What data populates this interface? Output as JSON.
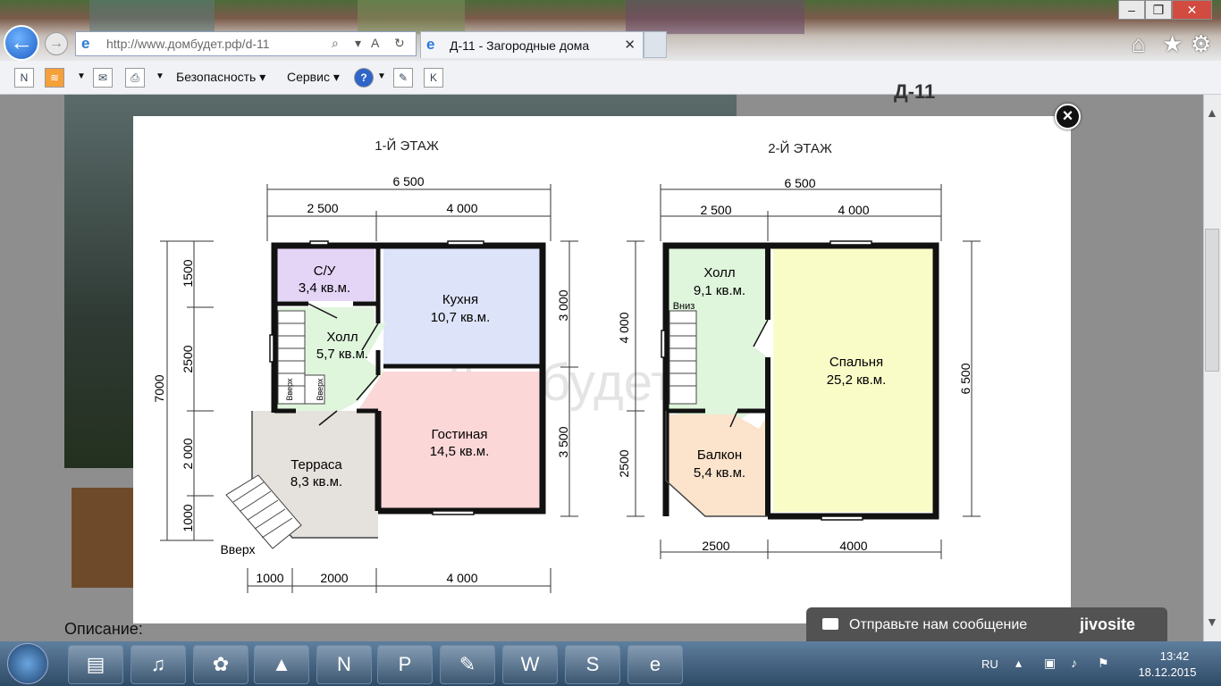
{
  "browser": {
    "url": "http://www.домбудет.рф/d-11",
    "tab_title": "Д-11 - Загородные дома",
    "minimize": "–",
    "restore": "❐",
    "close": "✕",
    "back_glyph": "←",
    "forward_glyph": "→",
    "tab_close": "✕",
    "home_icon": "⌂",
    "favorites_icon": "★",
    "settings_icon": "⚙"
  },
  "command_bar": {
    "security_label": "Безопасность",
    "service_label": "Сервис",
    "help_glyph": "?",
    "k_label": "K"
  },
  "page": {
    "description_label": "Описание:",
    "header_fragment": "Д-11"
  },
  "floorplan": {
    "watermark": "Домбудет.рф",
    "floor1": {
      "title": "1-Й ЭТАЖ",
      "dim_total_top": "6 500",
      "dim_top_left": "2 500",
      "dim_top_right": "4 000",
      "dim_left_total": "7000",
      "dim_left_1": "1500",
      "dim_left_2": "2500",
      "dim_left_3": "2 000",
      "dim_left_4": "1000",
      "dim_right_1": "3 000",
      "dim_right_2": "3 500",
      "dim_bottom_1": "1000",
      "dim_bottom_2": "2000",
      "dim_bottom_3": "4 000",
      "rooms": [
        {
          "name": "С/У",
          "area": "3,4 кв.м."
        },
        {
          "name": "Кухня",
          "area": "10,7 кв.м."
        },
        {
          "name": "Холл",
          "area": "5,7 кв.м."
        },
        {
          "name": "Гостиная",
          "area": "14,5 кв.м."
        },
        {
          "name": "Терраса",
          "area": "8,3 кв.м."
        }
      ],
      "stairs_up_1": "Вверх",
      "stairs_up_2": "Вверх",
      "terrace_up": "Вверх"
    },
    "floor2": {
      "title": "2-Й ЭТАЖ",
      "dim_total_top": "6 500",
      "dim_top_left": "2 500",
      "dim_top_right": "4 000",
      "dim_left_1": "4 000",
      "dim_left_2": "2500",
      "dim_right_total": "6 500",
      "dim_bottom_1": "2500",
      "dim_bottom_2": "4000",
      "rooms": [
        {
          "name": "Холл",
          "area": "9,1 кв.м."
        },
        {
          "name": "Спальня",
          "area": "25,2 кв.м."
        },
        {
          "name": "Балкон",
          "area": "5,4 кв.м."
        }
      ],
      "stairs_down": "Вниз"
    }
  },
  "chat": {
    "label": "Отправьте нам сообщение",
    "brand": "jivosite"
  },
  "taskbar": {
    "lang": "RU",
    "time": "13:42",
    "date": "18.12.2015"
  }
}
